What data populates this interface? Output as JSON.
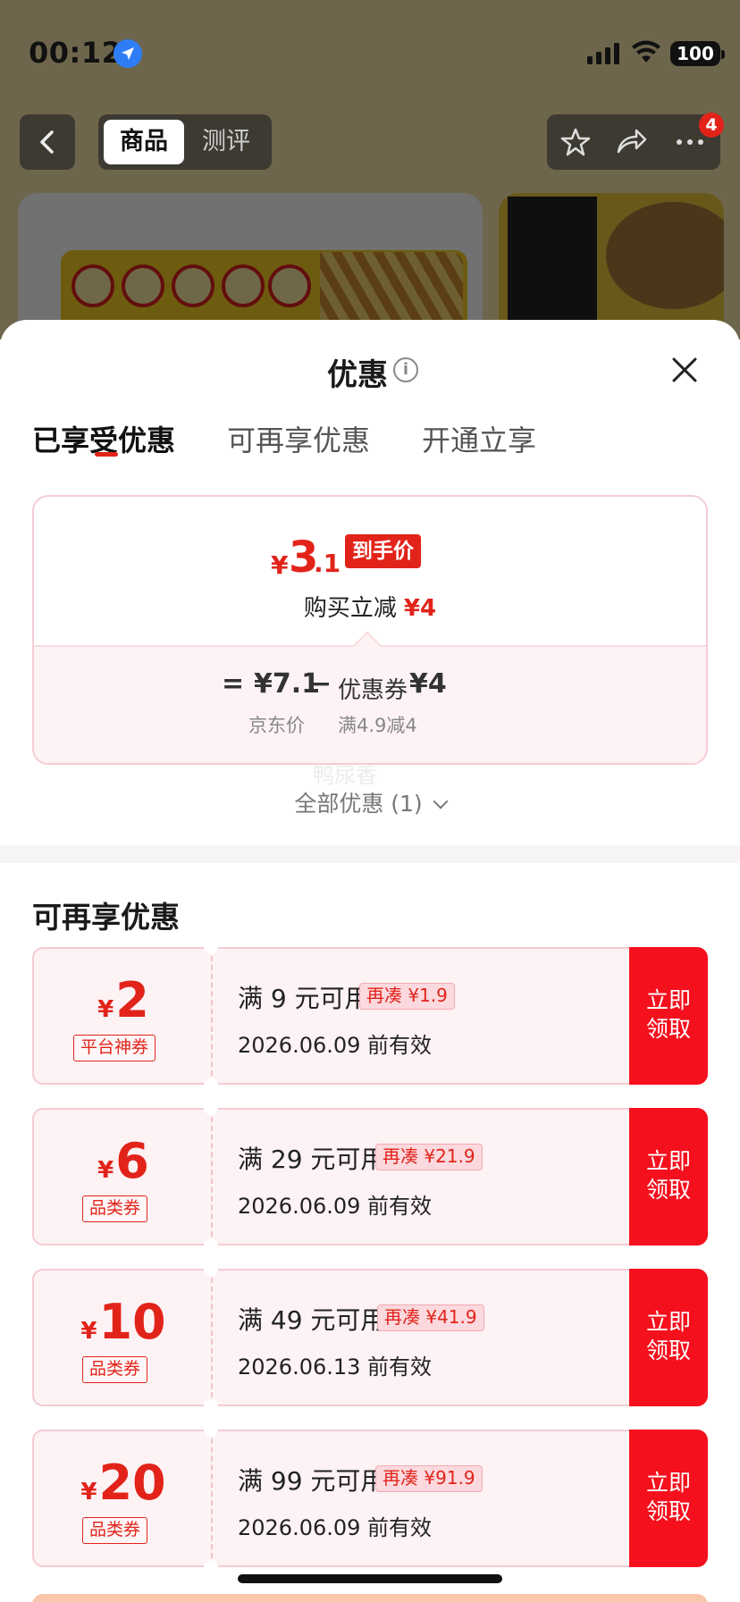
{
  "status_bar": {
    "time": "00:12",
    "battery": "100"
  },
  "nav": {
    "seg_active": "商品",
    "seg_inactive": "测评",
    "more_badge": "4"
  },
  "sheet": {
    "title": "优惠",
    "tabs": [
      "已享受优惠",
      "可再享优惠",
      "开通立享"
    ],
    "enjoyed": {
      "currency": "¥",
      "final_int": "3",
      "final_dec": ".1",
      "final_tag": "到手价",
      "instant_label": "购买立减",
      "instant_amount": "¥4",
      "equals": "=",
      "jd_price": "¥7.1",
      "jd_price_label": "京东价",
      "minus": "−",
      "coupon_label": "优惠券",
      "coupon_amount": "¥4",
      "coupon_rule": "满4.9减4"
    },
    "watermark": "鸭尿香",
    "all_promos": "全部优惠 (1)",
    "section_title": "可再享优惠",
    "coupons": [
      {
        "currency": "¥",
        "amount": "2",
        "type": "平台神券",
        "condition": "满 9 元可用",
        "more": "再凑 ¥1.9",
        "expiry": "2026.06.09 前有效",
        "button": "立即领取"
      },
      {
        "currency": "¥",
        "amount": "6",
        "type": "品类券",
        "condition": "满 29 元可用",
        "more": "再凑 ¥21.9",
        "expiry": "2026.06.09 前有效",
        "button": "立即领取"
      },
      {
        "currency": "¥",
        "amount": "10",
        "type": "品类券",
        "condition": "满 49 元可用",
        "more": "再凑 ¥41.9",
        "expiry": "2026.06.13 前有效",
        "button": "立即领取"
      },
      {
        "currency": "¥",
        "amount": "20",
        "type": "品类券",
        "condition": "满 99 元可用",
        "more": "再凑 ¥91.9",
        "expiry": "2026.06.09 前有效",
        "button": "立即领取"
      }
    ]
  },
  "colors": {
    "accent": "#e2231a",
    "button_red": "#f5101e",
    "coupon_bg": "#fdf2f4"
  },
  "icons": [
    "location-icon",
    "signal-icon",
    "wifi-icon",
    "battery-icon",
    "back-icon",
    "star-icon",
    "share-icon",
    "more-icon",
    "info-icon",
    "close-icon",
    "chevron-down-icon"
  ]
}
